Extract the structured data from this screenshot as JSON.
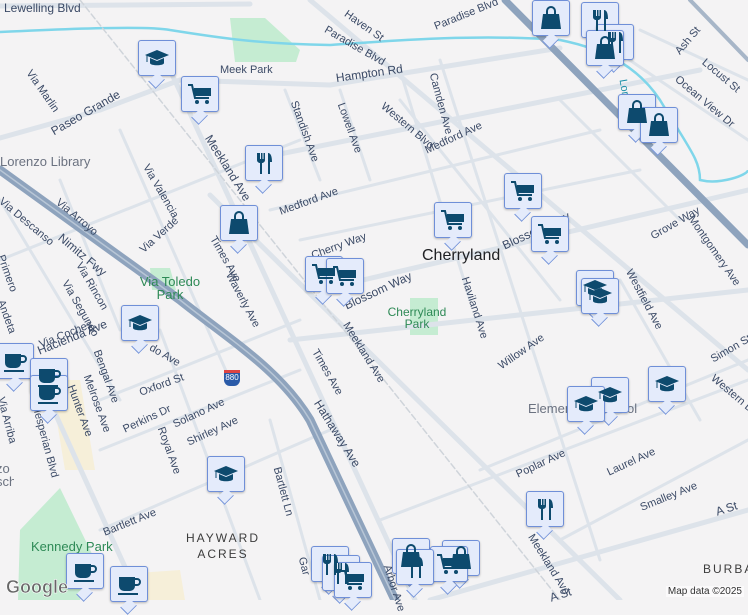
{
  "map": {
    "places": {
      "cherryland": "Cherryland",
      "hayward_acres": "HAYWARD\nACRES",
      "burbank": "BURBA"
    },
    "parks": {
      "meek": "Meek Park",
      "via_toledo": "Via Toledo Park",
      "cherryland": "Cherryland Park",
      "kennedy": "Kennedy Park"
    },
    "pois": {
      "library": "Lorenzo Library",
      "school_partial": "Elementary School",
      "lorenzo_school": "zo school"
    },
    "streets": {
      "lewelling": "Lewelling Blvd",
      "haven": "Haven St",
      "paradise1": "Paradise Blvd",
      "paradise2": "Paradise Blvd",
      "hampton": "Hampton Rd",
      "via_marlin": "Via Marlin",
      "paseo_grande": "Paseo Grande",
      "standish": "Standish Ave",
      "lowell": "Lowell Ave",
      "camden": "Camden Ave",
      "western1": "Western Blvd",
      "medford1": "Medford Ave",
      "medford2": "Medford Ave",
      "meekland1": "Meekland Ave",
      "meekland2": "Meekland Ave",
      "meekland3": "Meekland Ave",
      "via_valencia": "Via Valencia",
      "via_arroyo": "Via Arroyo",
      "via_descanso": "Via Descanso",
      "nimitz": "Nimitz Fwy",
      "via_verde": "Via Verde",
      "times1": "Times Ave",
      "times2": "Times Ave",
      "cherry": "Cherry Way",
      "blossom1": "Blossom Way",
      "blossom2": "Blossom Way",
      "haviland": "Haviland Ave",
      "grove": "Grove Way",
      "montgomery": "Montgomery Ave",
      "westfield": "Westfield Ave",
      "waverly": "Waverly Ave",
      "primero": "Primero",
      "via_rincon": "Via Rincon",
      "via_segundo": "Via Segundo",
      "andeta": "Andeta",
      "willow": "Willow Ave",
      "simon": "Simon St",
      "western2": "Western Blvd",
      "via_coches": "Via Coches",
      "hacienda": "Hacienda Ave",
      "bengal": "Bengal Ave",
      "melrose": "Melrose Ave",
      "hunter": "Hunter Ave",
      "oxford": "Oxford St",
      "perkins": "Perkins Dr",
      "royal": "Royal Ave",
      "solano": "Solano Ave",
      "shirley": "Shirley Ave",
      "hathaway": "Hathaway Ave",
      "bartlett_ln": "Bartlett Ln",
      "bartlett_ave": "Bartlett Ave",
      "poplar": "Poplar Ave",
      "laurel": "Laurel Ave",
      "smalley": "Smalley Ave",
      "a_st1": "A St",
      "a_st2": "A St",
      "arbor": "Arbor Ave",
      "ash": "Ash St",
      "locust": "Locust St",
      "ocean_view": "Ocean View Dr",
      "via_arriba": "Via Arriba",
      "hesperian": "Hesperian Blvd",
      "toledo": "do Ave",
      "lorenzo_creek": "Loren",
      "garden": "Gar"
    },
    "shield": "880",
    "attribution": "Map data ©2025",
    "logo": "Google"
  },
  "colors": {
    "marker_fill": "#e4ebfb",
    "marker_border": "#6f8fd8",
    "icon": "#0d4a6e",
    "freeway": "#8ea3bd",
    "creek": "#7fd6ea",
    "park": "#c5ecd2"
  }
}
